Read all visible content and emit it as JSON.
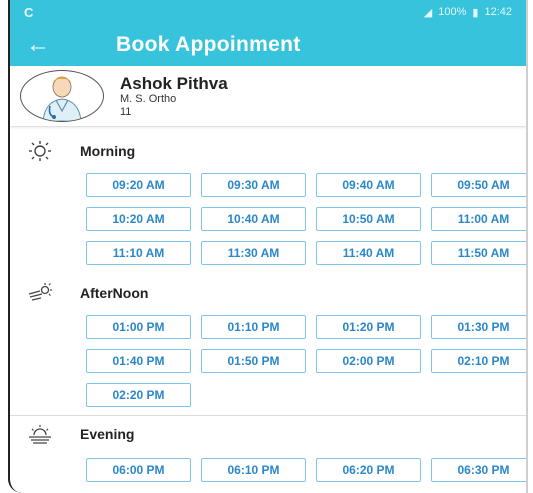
{
  "status": {
    "signal": "◢",
    "battery_text": "100%",
    "time": "12:42",
    "notif": "C"
  },
  "header": {
    "title": "Book Appoinment"
  },
  "doctor": {
    "name": "Ashok Pithva",
    "specialty": "M. S. Ortho",
    "number": "11"
  },
  "sections": [
    {
      "label": "Morning",
      "rows": [
        [
          "09:20 AM",
          "09:30 AM",
          "09:40 AM",
          "09:50 AM"
        ],
        [
          "10:20 AM",
          "10:40 AM",
          "10:50 AM",
          "11:00 AM"
        ],
        [
          "11:10 AM",
          "11:30 AM",
          "11:40 AM",
          "11:50 AM"
        ]
      ]
    },
    {
      "label": "AfterNoon",
      "rows": [
        [
          "01:00 PM",
          "01:10 PM",
          "01:20 PM",
          "01:30 PM"
        ],
        [
          "01:40 PM",
          "01:50 PM",
          "02:00 PM",
          "02:10 PM"
        ],
        [
          "02:20 PM"
        ]
      ]
    },
    {
      "label": "Evening",
      "rows": [
        [
          "06:00 PM",
          "06:10 PM",
          "06:20 PM",
          "06:30 PM"
        ]
      ]
    }
  ],
  "colors": {
    "primary": "#37c3dc",
    "slot_text": "#2a87c9",
    "slot_border": "#7cc7e8"
  }
}
